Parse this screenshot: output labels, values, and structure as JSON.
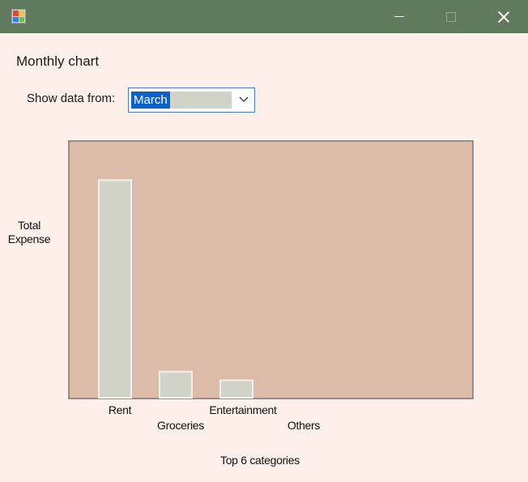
{
  "window": {
    "titlebar_color": "#5f7a5c",
    "icons": [
      "app-icon",
      "minimize-icon",
      "maximize-icon",
      "close-icon"
    ]
  },
  "heading": "Monthly chart",
  "filter": {
    "label": "Show data from:",
    "selected": "March"
  },
  "colors": {
    "plot_background": "#dcbca9",
    "bar_fill": "#d2d3c8",
    "bar_border": "#f4f1ec",
    "selection": "#0b63c9"
  },
  "chart_data": {
    "type": "bar",
    "categories": [
      "Rent",
      "Groceries",
      "Entertainment",
      "Others"
    ],
    "values": [
      100,
      12,
      8,
      0
    ],
    "xlabel": "Top 6 categories",
    "ylabel": "Total Expense",
    "ylim": [
      0,
      118
    ],
    "grid": false,
    "legend": "none"
  }
}
